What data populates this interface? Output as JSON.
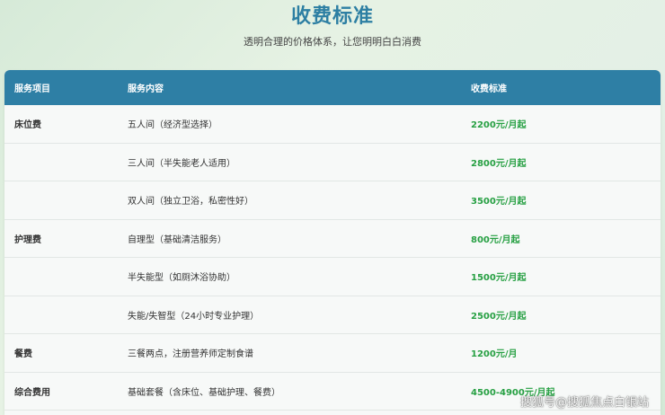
{
  "header": {
    "title": "收费标准",
    "subtitle": "透明合理的价格体系，让您明明白白消费"
  },
  "table": {
    "columns": [
      "服务项目",
      "服务内容",
      "收费标准"
    ],
    "rows": [
      {
        "item": "床位费",
        "content": "五人间（经济型选择）",
        "price": "2200元/月起"
      },
      {
        "item": "",
        "content": "三人间（半失能老人适用）",
        "price": "2800元/月起"
      },
      {
        "item": "",
        "content": "双人间（独立卫浴，私密性好）",
        "price": "3500元/月起"
      },
      {
        "item": "护理费",
        "content": "自理型（基础清洁服务）",
        "price": "800元/月起"
      },
      {
        "item": "",
        "content": "半失能型（如厕沐浴协助）",
        "price": "1500元/月起"
      },
      {
        "item": "",
        "content": "失能/失智型（24小时专业护理）",
        "price": "2500元/月起"
      },
      {
        "item": "餐费",
        "content": "三餐两点，注册营养师定制食谱",
        "price": "1200元/月"
      },
      {
        "item": "综合费用",
        "content": "基础套餐（含床位、基础护理、餐费）",
        "price": "4500-4900元/月起"
      }
    ]
  },
  "watermark": "搜狐号@搜狐焦点白银站",
  "colors": {
    "header_bg": "#2e7fa5",
    "title": "#2d7fa3",
    "price": "#27a043"
  }
}
